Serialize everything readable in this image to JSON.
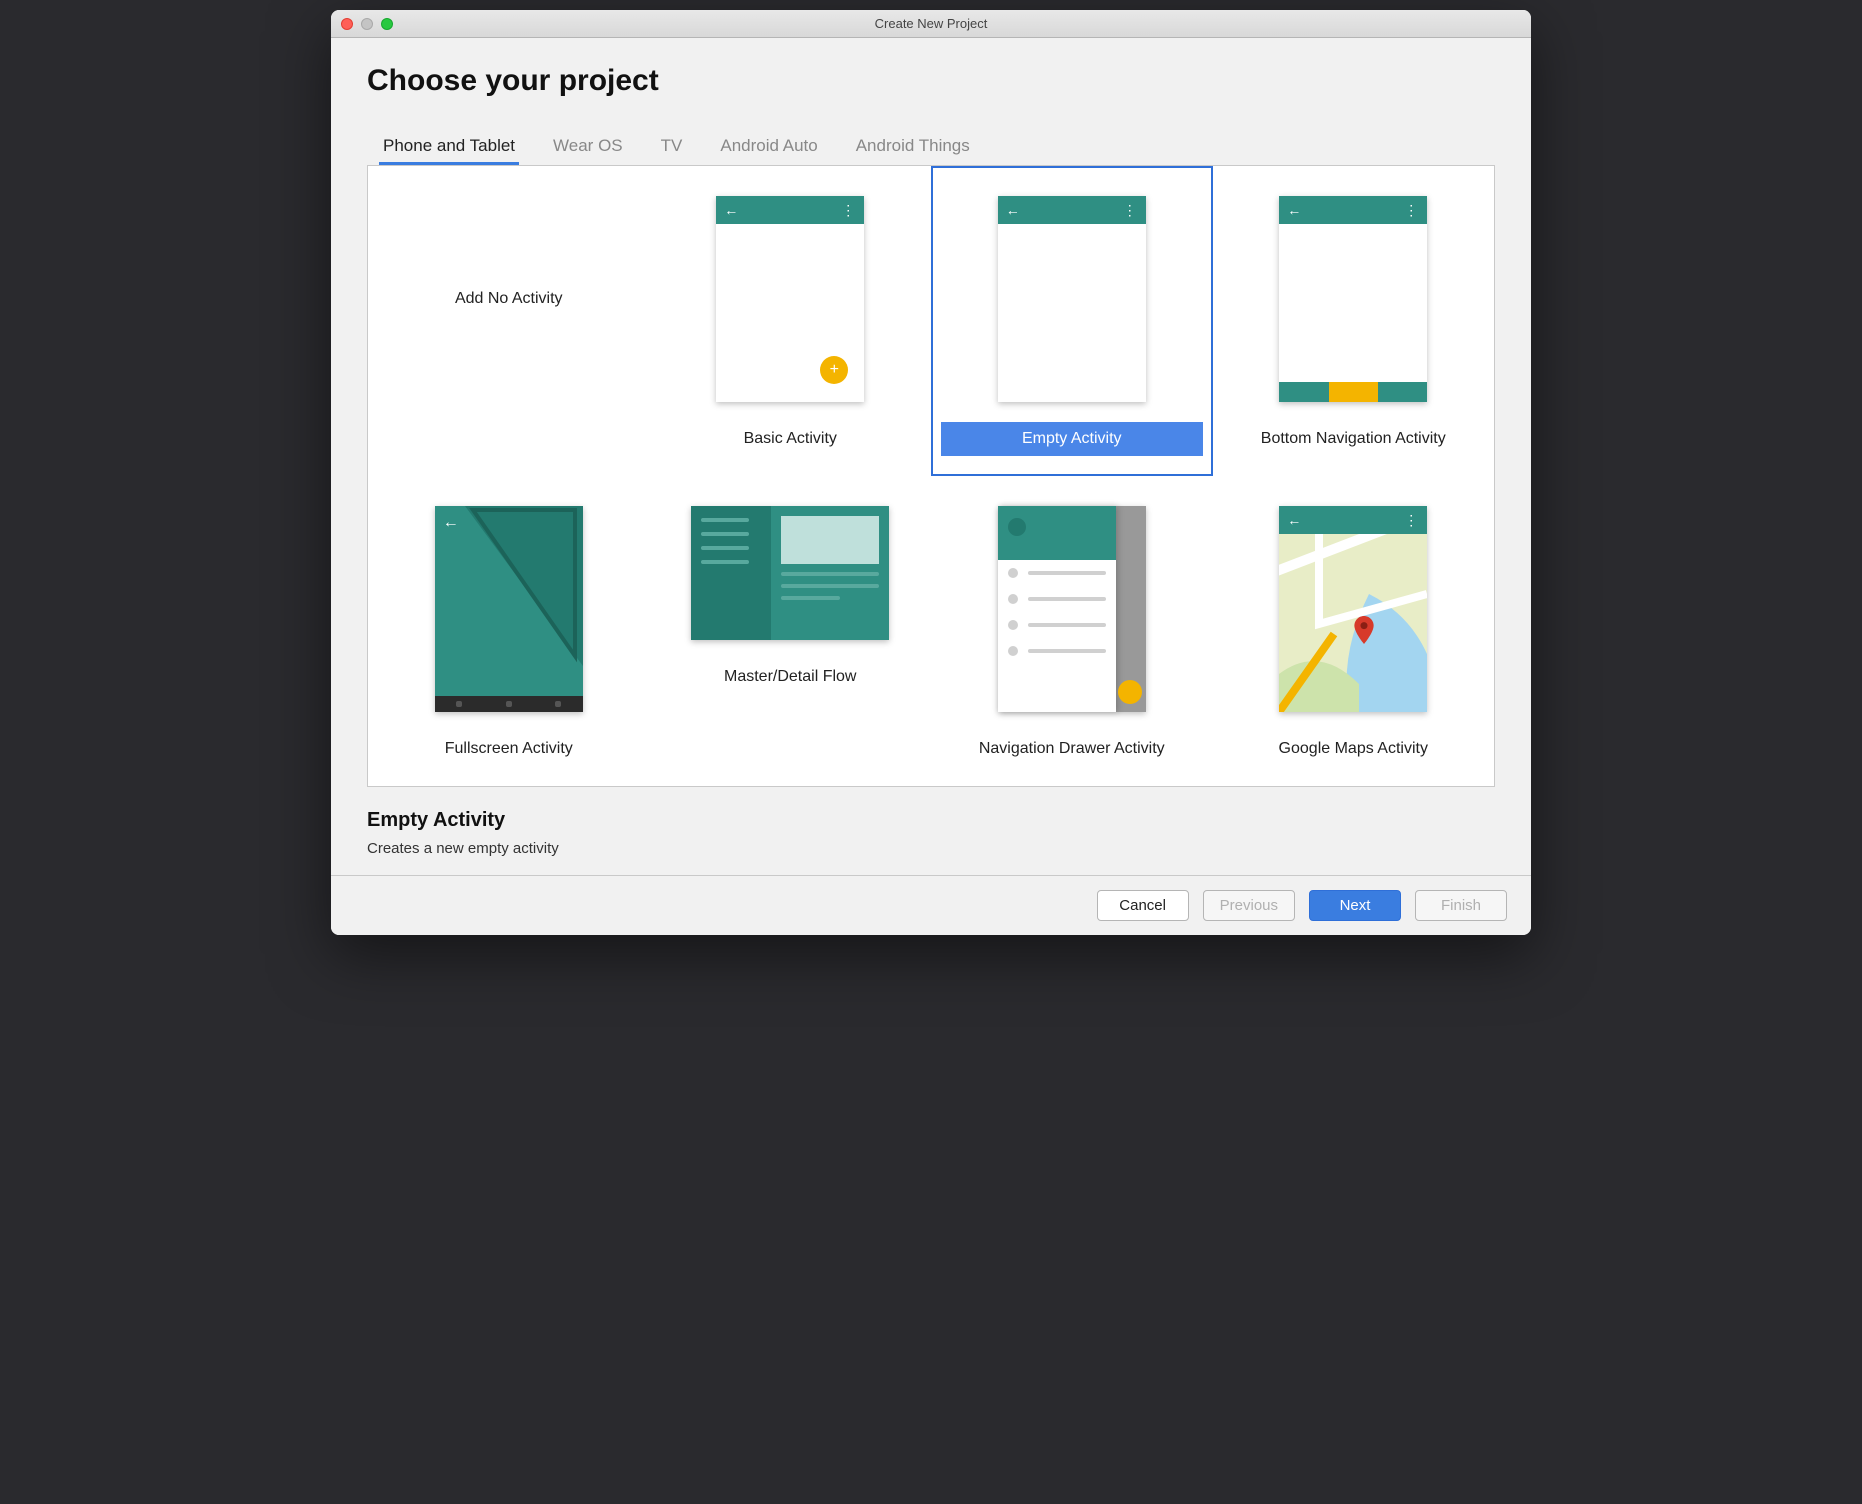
{
  "window": {
    "title": "Create New Project"
  },
  "header": {
    "page_title": "Choose your project"
  },
  "tabs": [
    {
      "label": "Phone and Tablet",
      "active": true
    },
    {
      "label": "Wear OS",
      "active": false
    },
    {
      "label": "TV",
      "active": false
    },
    {
      "label": "Android Auto",
      "active": false
    },
    {
      "label": "Android Things",
      "active": false
    }
  ],
  "templates": [
    {
      "id": "no-activity",
      "label": "Add No Activity",
      "selected": false
    },
    {
      "id": "basic",
      "label": "Basic Activity",
      "selected": false
    },
    {
      "id": "empty",
      "label": "Empty Activity",
      "selected": true
    },
    {
      "id": "bottom-nav",
      "label": "Bottom Navigation Activity",
      "selected": false
    },
    {
      "id": "fullscreen",
      "label": "Fullscreen Activity",
      "selected": false
    },
    {
      "id": "master-detail",
      "label": "Master/Detail Flow",
      "selected": false
    },
    {
      "id": "nav-drawer",
      "label": "Navigation Drawer Activity",
      "selected": false
    },
    {
      "id": "maps",
      "label": "Google Maps Activity",
      "selected": false
    }
  ],
  "detail": {
    "title": "Empty Activity",
    "description": "Creates a new empty activity"
  },
  "footer": {
    "cancel": "Cancel",
    "previous": "Previous",
    "next": "Next",
    "finish": "Finish"
  }
}
